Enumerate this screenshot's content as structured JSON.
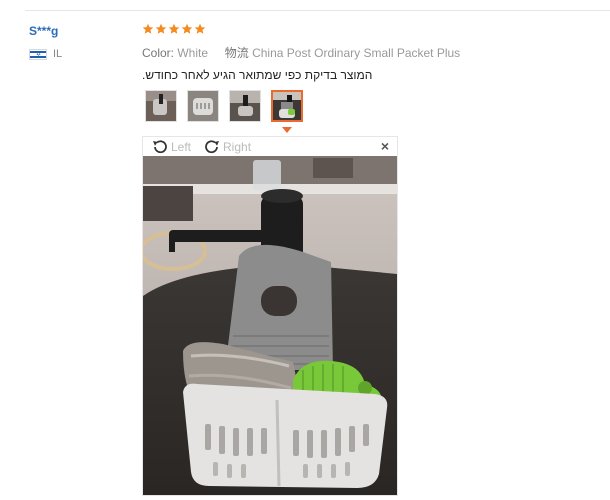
{
  "review": {
    "user_name": "S***g",
    "country_code": "IL",
    "rating": 5,
    "color_label": "Color:",
    "color_value": "White",
    "shipping_label": "物流",
    "shipping_value": "China Post Ordinary Small Packet Plus",
    "feedback_text": "המוצר בדיקת כפי שמתואר הגיע לאחר כחודש."
  },
  "viewer": {
    "rotate_left_label": "Left",
    "rotate_right_label": "Right",
    "close_label": "×"
  },
  "colors": {
    "star": "#f58a1f",
    "active_thumb_border": "#e96b2f",
    "username": "#2a6bb8"
  },
  "icons": {
    "rotate_left": "rotate-left-icon",
    "rotate_right": "rotate-right-icon",
    "close": "close-icon",
    "flag": "israel-flag-icon"
  }
}
